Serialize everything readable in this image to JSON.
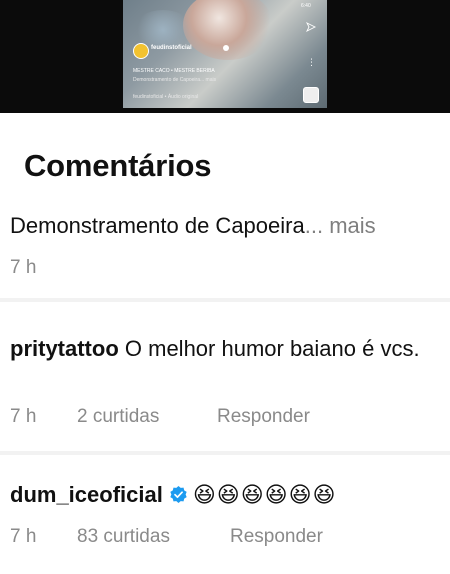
{
  "video": {
    "username": "feudinstoficial",
    "line1": "MESTRE CACO • MESTRE BERIBA",
    "line2": "Demonstramento de Capoeira... mais",
    "line3": "feudinstoficial • Áudio original",
    "top_number": "6:40"
  },
  "comments_title": "Comentários",
  "caption": {
    "text": "Demonstramento de Capoeira",
    "ellipsis": "...",
    "more_label": "mais",
    "time": "7 h"
  },
  "comments": [
    {
      "username": "pritytattoo",
      "text": "O melhor humor baiano é vcs.",
      "time": "7 h",
      "likes": "2 curtidas",
      "reply_label": "Responder"
    },
    {
      "username": "dum_iceoficial",
      "verified": true,
      "text": "😆😆😆😆😆😆",
      "time": "7 h",
      "likes": "83 curtidas",
      "reply_label": "Responder"
    }
  ],
  "colors": {
    "text": "#111111",
    "muted": "#8a8a8a",
    "verified": "#1d9bf0",
    "divider": "#f2f2f2"
  },
  "icons": [
    "send-icon",
    "more-icon",
    "verified-icon",
    "audio-thumb-icon"
  ]
}
